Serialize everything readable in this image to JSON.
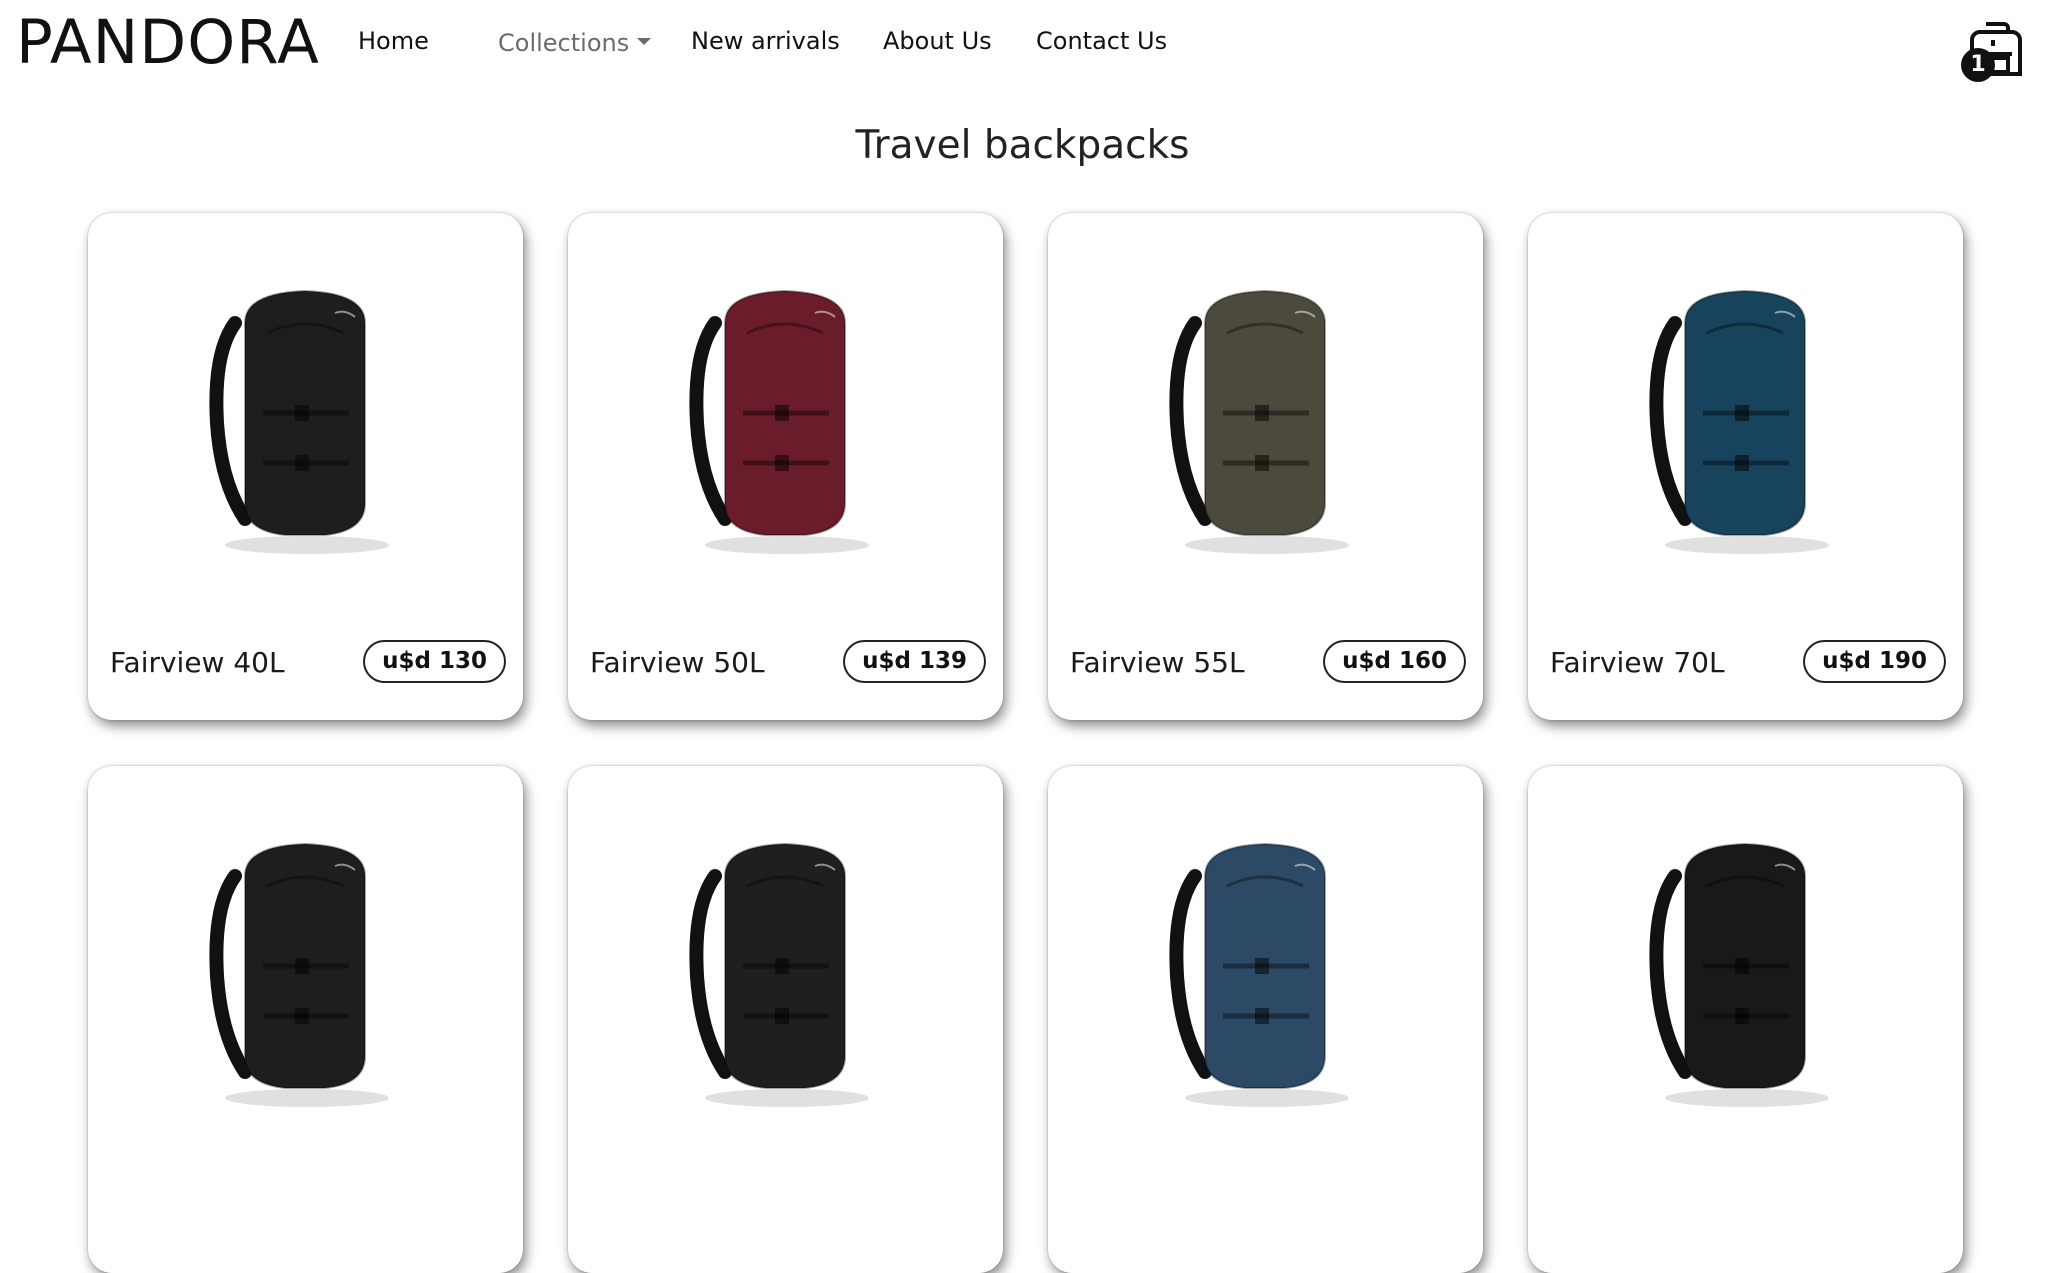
{
  "brand": "PANDORA",
  "nav": {
    "home": "Home",
    "collections": "Collections",
    "new_arrivals": "New arrivals",
    "about": "About Us",
    "contact": "Contact Us"
  },
  "cart": {
    "count": "1"
  },
  "page_title": "Travel backpacks",
  "products": [
    {
      "name": "Fairview 40L",
      "price": "u$d 130",
      "color": "#1e1e20"
    },
    {
      "name": "Fairview 50L",
      "price": "u$d 139",
      "color": "#6b1c2a"
    },
    {
      "name": "Fairview 55L",
      "price": "u$d 160",
      "color": "#4b4a3c"
    },
    {
      "name": "Fairview 70L",
      "price": "u$d 190",
      "color": "#17445c"
    },
    {
      "name": "",
      "price": "",
      "color": "#1e1e20"
    },
    {
      "name": "",
      "price": "",
      "color": "#1f1f21"
    },
    {
      "name": "",
      "price": "",
      "color": "#2c4a66"
    },
    {
      "name": "",
      "price": "",
      "color": "#19191b"
    }
  ]
}
